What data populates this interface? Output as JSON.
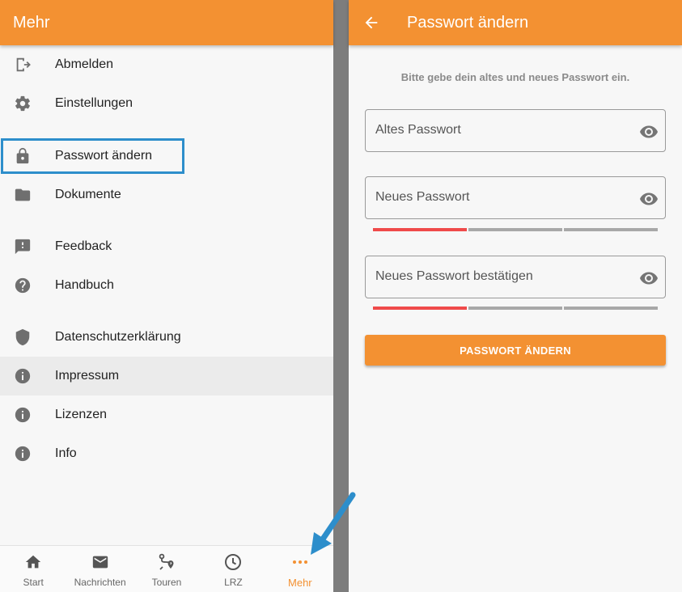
{
  "colors": {
    "accent": "#f39132",
    "highlight": "#2d8ecb",
    "weak": "#ef4a4a",
    "icon": "#6f6f6f"
  },
  "left": {
    "appbar_title": "Mehr",
    "menu": [
      {
        "label": "Abmelden",
        "icon": "logout-icon"
      },
      {
        "label": "Einstellungen",
        "icon": "gear-icon"
      },
      {
        "label": "Passwort ändern",
        "icon": "lock-icon"
      },
      {
        "label": "Dokumente",
        "icon": "folder-icon"
      },
      {
        "label": "Feedback",
        "icon": "feedback-icon"
      },
      {
        "label": "Handbuch",
        "icon": "help-icon"
      },
      {
        "label": "Datenschutzerklärung",
        "icon": "shield-icon"
      },
      {
        "label": "Impressum",
        "icon": "info-icon"
      },
      {
        "label": "Lizenzen",
        "icon": "info-icon"
      },
      {
        "label": "Info",
        "icon": "info-icon"
      }
    ],
    "bottom_nav": [
      {
        "label": "Start",
        "icon": "home-icon"
      },
      {
        "label": "Nachrichten",
        "icon": "mail-icon"
      },
      {
        "label": "Touren",
        "icon": "route-icon"
      },
      {
        "label": "LRZ",
        "icon": "clock-icon"
      },
      {
        "label": "Mehr",
        "icon": "more-icon",
        "active": true
      }
    ]
  },
  "right": {
    "appbar_title": "Passwort ändern",
    "hint": "Bitte gebe dein altes und neues Passwort ein.",
    "fields": {
      "old": {
        "placeholder": "Altes Passwort"
      },
      "new": {
        "placeholder": "Neues Passwort",
        "strength_segments_filled": 1,
        "strength_segments_total": 3
      },
      "confirm": {
        "placeholder": "Neues Passwort bestätigen",
        "strength_segments_filled": 1,
        "strength_segments_total": 3
      }
    },
    "submit_label": "PASSWORT ÄNDERN"
  }
}
